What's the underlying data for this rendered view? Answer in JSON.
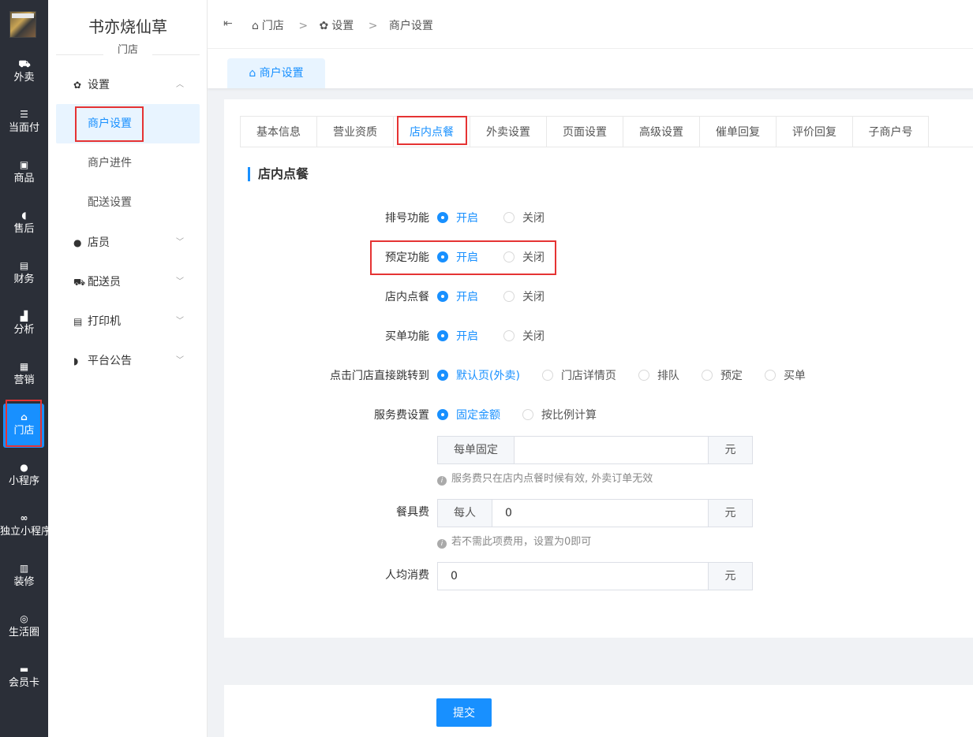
{
  "nav": {
    "items": [
      {
        "icon": "scooter-icon",
        "glyph": "⛟",
        "label": "外卖"
      },
      {
        "icon": "list-icon",
        "glyph": "☰",
        "label": "当面付"
      },
      {
        "icon": "box-icon",
        "glyph": "▣",
        "label": "商品"
      },
      {
        "icon": "headset-icon",
        "glyph": "◖",
        "label": "售后"
      },
      {
        "icon": "receipt-icon",
        "glyph": "▤",
        "label": "财务"
      },
      {
        "icon": "bar-chart-icon",
        "glyph": "▟",
        "label": "分析"
      },
      {
        "icon": "gift-icon",
        "glyph": "▦",
        "label": "营销"
      },
      {
        "icon": "store-icon",
        "glyph": "⌂",
        "label": "门店"
      },
      {
        "icon": "wechat-icon",
        "glyph": "●",
        "label": "小程序"
      },
      {
        "icon": "link-icon",
        "glyph": "∞",
        "label": "独立小程序"
      },
      {
        "icon": "decorate-icon",
        "glyph": "▥",
        "label": "装修"
      },
      {
        "icon": "circle-icon",
        "glyph": "◎",
        "label": "生活圈"
      },
      {
        "icon": "card-icon",
        "glyph": "▬",
        "label": "会员卡"
      }
    ]
  },
  "side": {
    "shop_name": "书亦烧仙草",
    "shop_sub": "门店",
    "groups": {
      "settings": {
        "icon": "gear-icon",
        "glyph": "✿",
        "label": "设置",
        "chev": "︿"
      },
      "staff": {
        "icon": "users-icon",
        "glyph": "●",
        "label": "店员",
        "chev": "﹀"
      },
      "courier": {
        "icon": "delivery-icon",
        "glyph": "⛟",
        "label": "配送员",
        "chev": "﹀"
      },
      "printer": {
        "icon": "printer-icon",
        "glyph": "▤",
        "label": "打印机",
        "chev": "﹀"
      },
      "notice": {
        "icon": "announce-icon",
        "glyph": "◗",
        "label": "平台公告",
        "chev": "﹀"
      }
    },
    "subs": [
      "商户设置",
      "商户进件",
      "配送设置"
    ]
  },
  "header": {
    "fold": "⇤",
    "crumbs": [
      "门店",
      "设置",
      "商户设置"
    ],
    "sep": ">",
    "page_tab": "商户设置"
  },
  "tabs": [
    "基本信息",
    "营业资质",
    "店内点餐",
    "外卖设置",
    "页面设置",
    "高级设置",
    "催单回复",
    "评价回复",
    "子商户号"
  ],
  "section_title": "店内点餐",
  "form": {
    "queue": {
      "label": "排号功能",
      "options": [
        "开启",
        "关闭"
      ],
      "selected": 0
    },
    "reserve": {
      "label": "预定功能",
      "options": [
        "开启",
        "关闭"
      ],
      "selected": 0
    },
    "dine_in": {
      "label": "店内点餐",
      "options": [
        "开启",
        "关闭"
      ],
      "selected": 0
    },
    "pay": {
      "label": "买单功能",
      "options": [
        "开启",
        "关闭"
      ],
      "selected": 0
    },
    "jump": {
      "label": "点击门店直接跳转到",
      "options": [
        "默认页(外卖)",
        "门店详情页",
        "排队",
        "预定",
        "买单"
      ],
      "selected": 0
    },
    "service_fee": {
      "label": "服务费设置",
      "options": [
        "固定金额",
        "按比例计算"
      ],
      "selected": 0,
      "prefix": "每单固定",
      "value": "",
      "suffix": "元",
      "hint": "服务费只在店内点餐时候有效, 外卖订单无效"
    },
    "tableware": {
      "label": "餐具费",
      "prefix": "每人",
      "value": "0",
      "suffix": "元",
      "hint": "若不需此项费用，设置为0即可"
    },
    "avg": {
      "label": "人均消费",
      "value": "0",
      "suffix": "元"
    }
  },
  "submit_label": "提交",
  "colors": {
    "accent": "#1890ff",
    "nav_bg": "#2b2f38",
    "highlight": "#e53333"
  }
}
